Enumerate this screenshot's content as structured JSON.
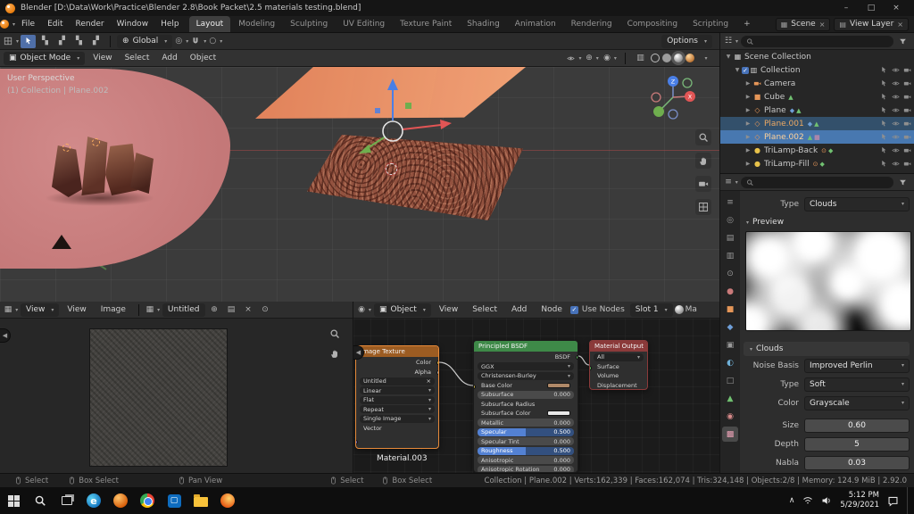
{
  "window": {
    "title": "Blender [D:\\Data\\Work\\Practice\\Blender 2.8\\Book Packet\\2.5 materials testing.blend]",
    "minimize": "–",
    "maximize": "□",
    "close": "×"
  },
  "topbar": {
    "menus": [
      "File",
      "Edit",
      "Render",
      "Window",
      "Help"
    ],
    "workspaces": [
      "Layout",
      "Modeling",
      "Sculpting",
      "UV Editing",
      "Texture Paint",
      "Shading",
      "Animation",
      "Rendering",
      "Compositing",
      "Scripting"
    ],
    "add_workspace": "+",
    "scene": "Scene",
    "view_layer": "View Layer"
  },
  "tool_settings": {
    "orientation": "Global",
    "options": "Options"
  },
  "viewport": {
    "mode": "Object Mode",
    "menus": [
      "View",
      "Select",
      "Add",
      "Object"
    ],
    "overlay_line1": "User Perspective",
    "overlay_line2": "(1) Collection | Plane.002",
    "nav_x": "X",
    "nav_z": "Z"
  },
  "outliner": {
    "rows": [
      {
        "label": "Scene Collection"
      },
      {
        "label": "Collection"
      },
      {
        "label": "Camera"
      },
      {
        "label": "Cube"
      },
      {
        "label": "Plane"
      },
      {
        "label": "Plane.001"
      },
      {
        "label": "Plane.002"
      },
      {
        "label": "TriLamp-Back"
      },
      {
        "label": "TriLamp-Fill"
      }
    ]
  },
  "properties": {
    "type_label": "Type",
    "type_value": "Clouds",
    "preview_section": "Preview",
    "clouds_section": "Clouds",
    "fields": [
      {
        "label": "Noise Basis",
        "value": "Improved Perlin"
      },
      {
        "label": "Type",
        "value": "Soft"
      },
      {
        "label": "Color",
        "value": "Grayscale"
      },
      {
        "label": "Size",
        "value": "0.60"
      },
      {
        "label": "Depth",
        "value": "5"
      },
      {
        "label": "Nabla",
        "value": "0.03"
      }
    ]
  },
  "image_editor": {
    "mode": "View",
    "menus": [
      "View",
      "Image"
    ],
    "image_name": "Untitled"
  },
  "shader_editor": {
    "context": "Object",
    "menus": [
      "View",
      "Select",
      "Add",
      "Node"
    ],
    "use_nodes": "Use Nodes",
    "slot": "Slot 1",
    "material_trunc": "Ma",
    "texture_node": {
      "header": "Image Texture",
      "outputs": [
        "Color",
        "Alpha"
      ],
      "image_name": "Untitled",
      "dropdowns": [
        "Linear",
        "Flat",
        "Repeat",
        "Single Image"
      ],
      "vector_input": "Vector",
      "label": "Material.003"
    },
    "principled_node": {
      "title": "Principled BSDF",
      "output": "BSDF",
      "dropdown1": "GGX",
      "dropdown2": "Christensen-Burley",
      "rows": [
        {
          "label": "Base Color"
        },
        {
          "label": "Subsurface",
          "value": "0.000"
        },
        {
          "label": "Subsurface Radius"
        },
        {
          "label": "Subsurface Color"
        },
        {
          "label": "Metallic",
          "value": "0.000"
        },
        {
          "label": "Specular",
          "value": "0.500"
        },
        {
          "label": "Specular Tint",
          "value": "0.000"
        },
        {
          "label": "Roughness",
          "value": "0.500"
        },
        {
          "label": "Anisotropic",
          "value": "0.000"
        },
        {
          "label": "Anisotropic Rotation",
          "value": "0.000"
        }
      ]
    },
    "output_node": {
      "title": "Material Output",
      "target": "All",
      "inputs": [
        "Surface",
        "Volume",
        "Displacement"
      ]
    }
  },
  "status_bar": {
    "hints": [
      "Select",
      "Box Select",
      "Pan View",
      "Select",
      "Box Select"
    ],
    "info": "Collection | Plane.002 | Verts:162,339 | Faces:162,074 | Tris:324,148 | Objects:2/8 | Memory: 124.9 MiB | 2.92.0"
  },
  "taskbar": {
    "time": "5:12 PM",
    "date": "5/29/2021"
  }
}
